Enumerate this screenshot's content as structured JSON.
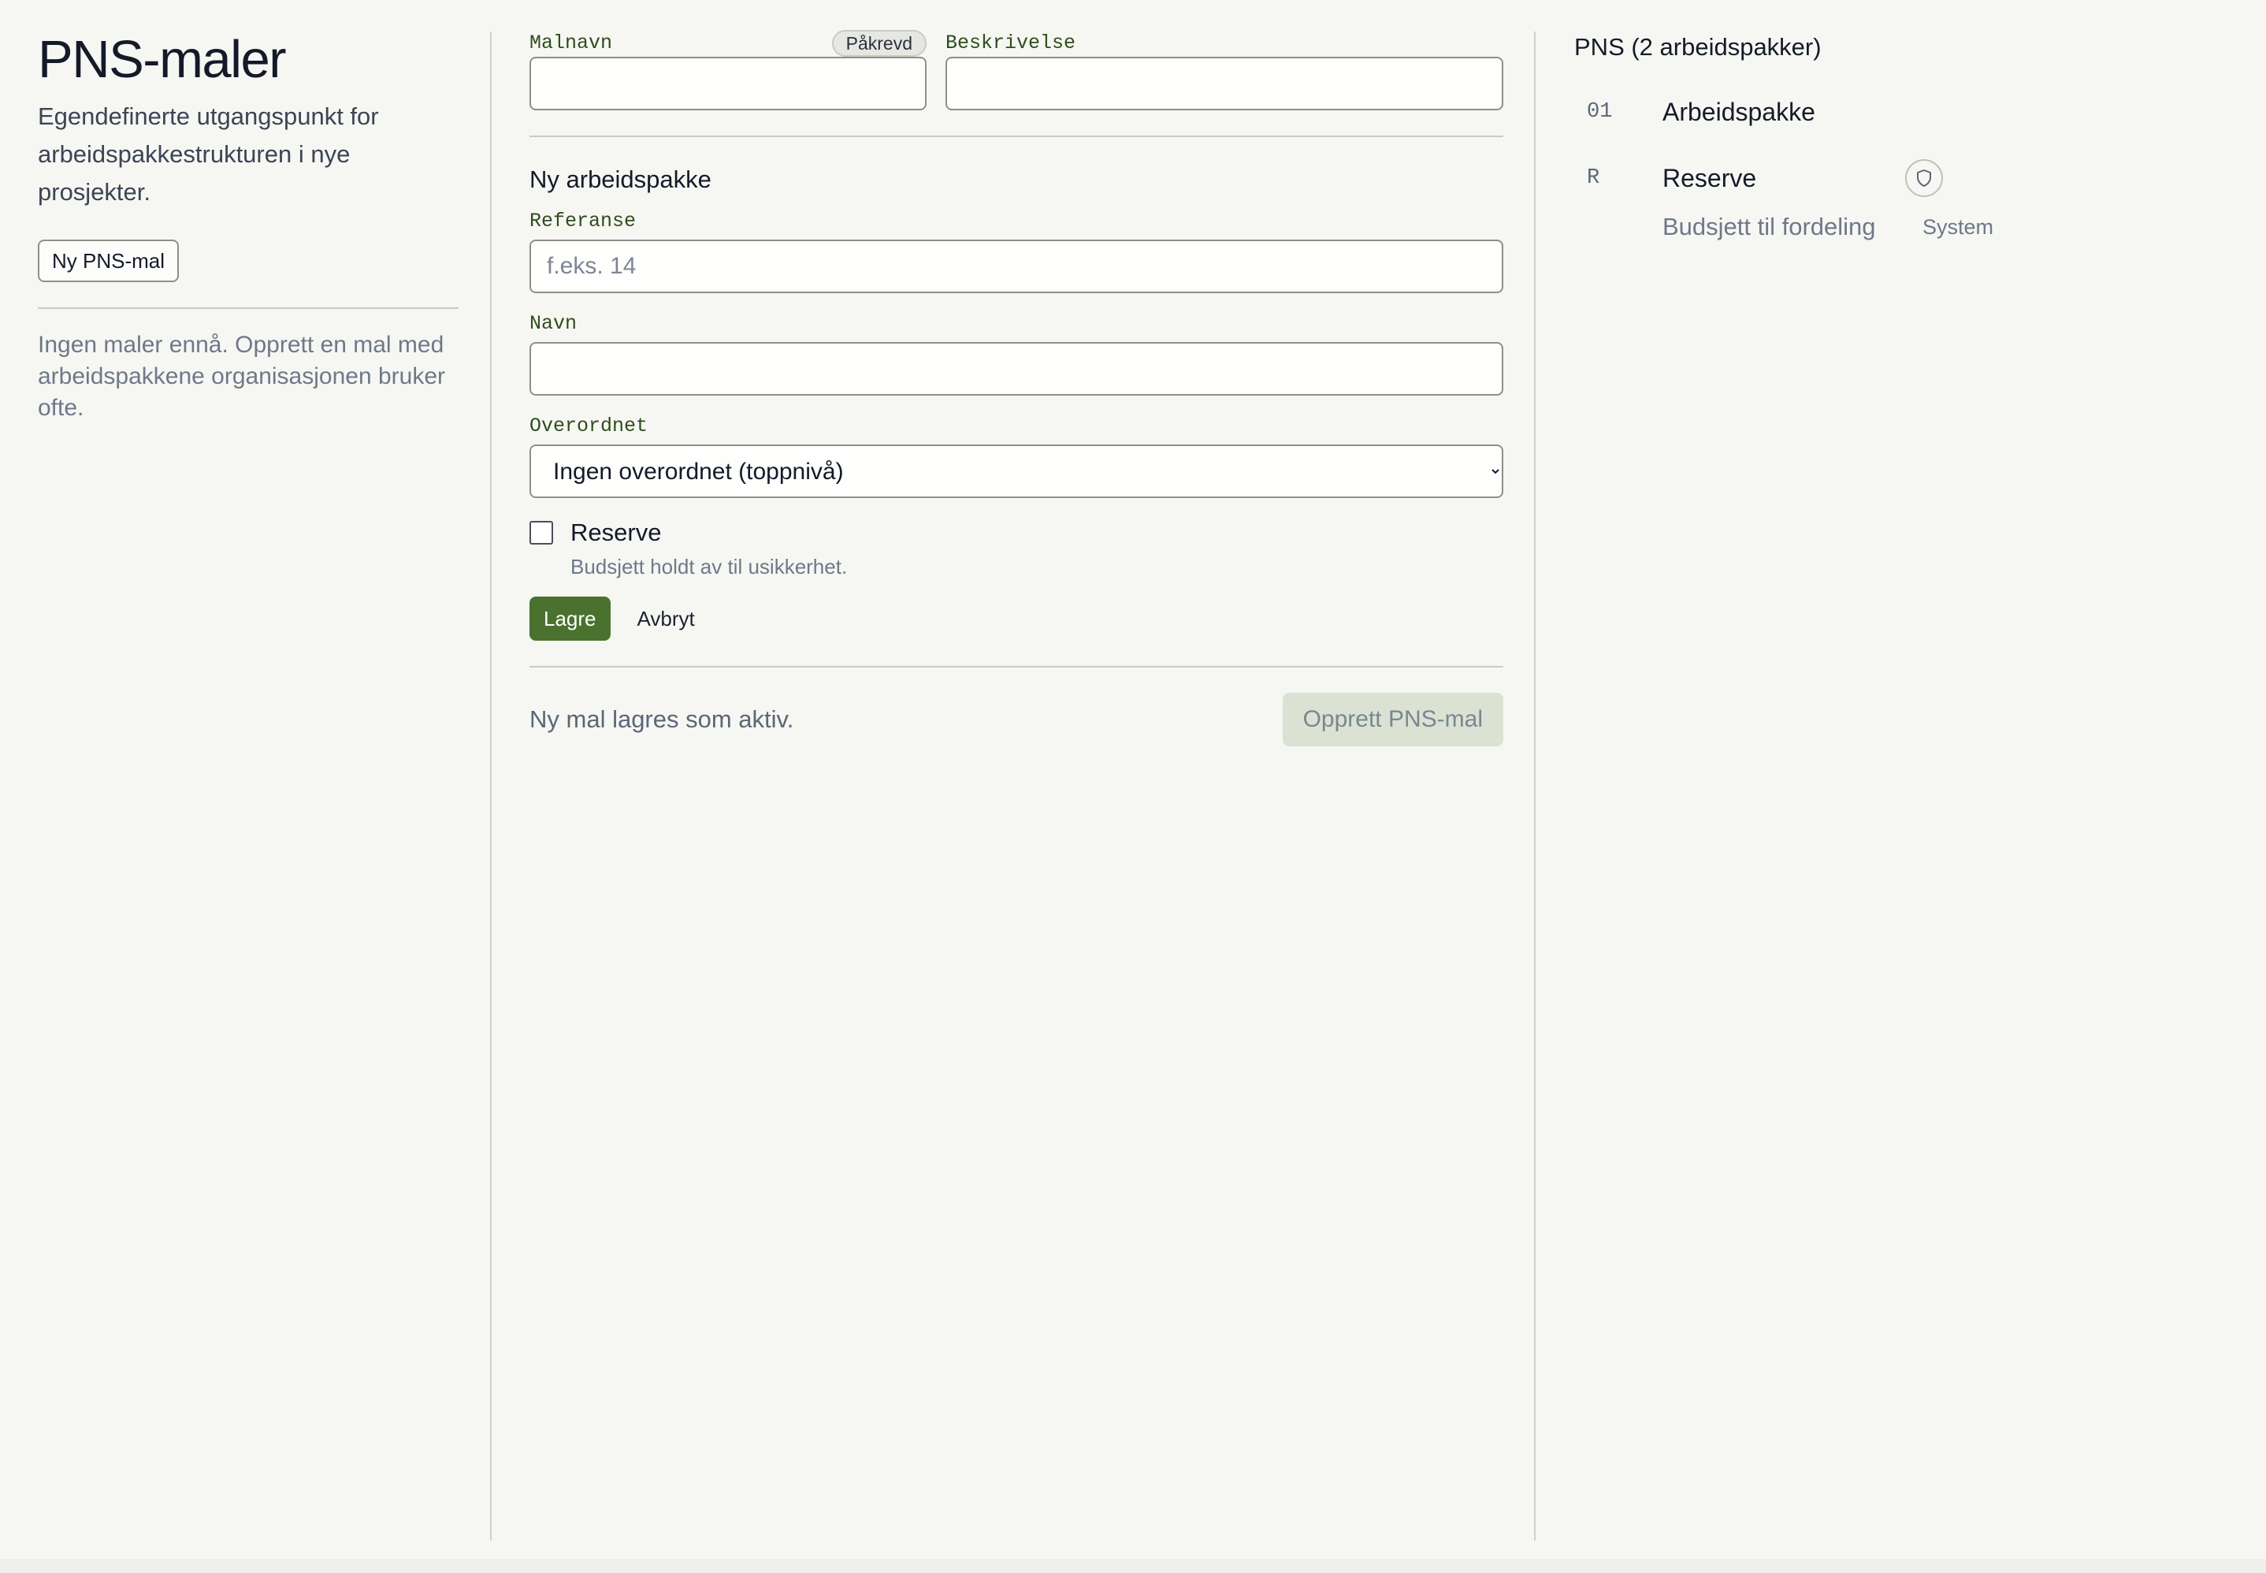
{
  "left": {
    "title": "PNS-maler",
    "description": "Egendefinerte utgangspunkt for arbeidspakkestrukturen i nye prosjekter.",
    "new_button": "Ny PNS-mal",
    "empty_text": "Ingen maler ennå. Opprett en mal med arbeidspakkene organisasjonen bruker ofte."
  },
  "form": {
    "name_label": "Malnavn",
    "required_badge": "Påkrevd",
    "name_value": "",
    "description_label": "Beskrivelse",
    "description_value": "",
    "section_title": "Ny arbeidspakke",
    "reference_label": "Referanse",
    "reference_placeholder": "f.eks. 14",
    "wp_name_label": "Navn",
    "wp_name_value": "",
    "parent_label": "Overordnet",
    "parent_selected": "Ingen overordnet (toppnivå)",
    "reserve_label": "Reserve",
    "reserve_checked": false,
    "reserve_help": "Budsjett holdt av til usikkerhet.",
    "save_button": "Lagre",
    "cancel_button": "Avbryt",
    "footer_note": "Ny mal lagres som aktiv.",
    "create_button": "Opprett PNS-mal"
  },
  "preview": {
    "title": "PNS (2 arbeidspakker)",
    "packages": [
      {
        "code": "01",
        "name": "Arbeidspakke"
      },
      {
        "code": "R",
        "name": "Reserve",
        "icon": "shield-icon",
        "sub_label": "Budsjett til fordeling",
        "sub_tag": "System"
      }
    ]
  },
  "colors": {
    "accent": "#4a722e",
    "label_green": "#2f4d1c",
    "background": "#f6f7f3"
  }
}
